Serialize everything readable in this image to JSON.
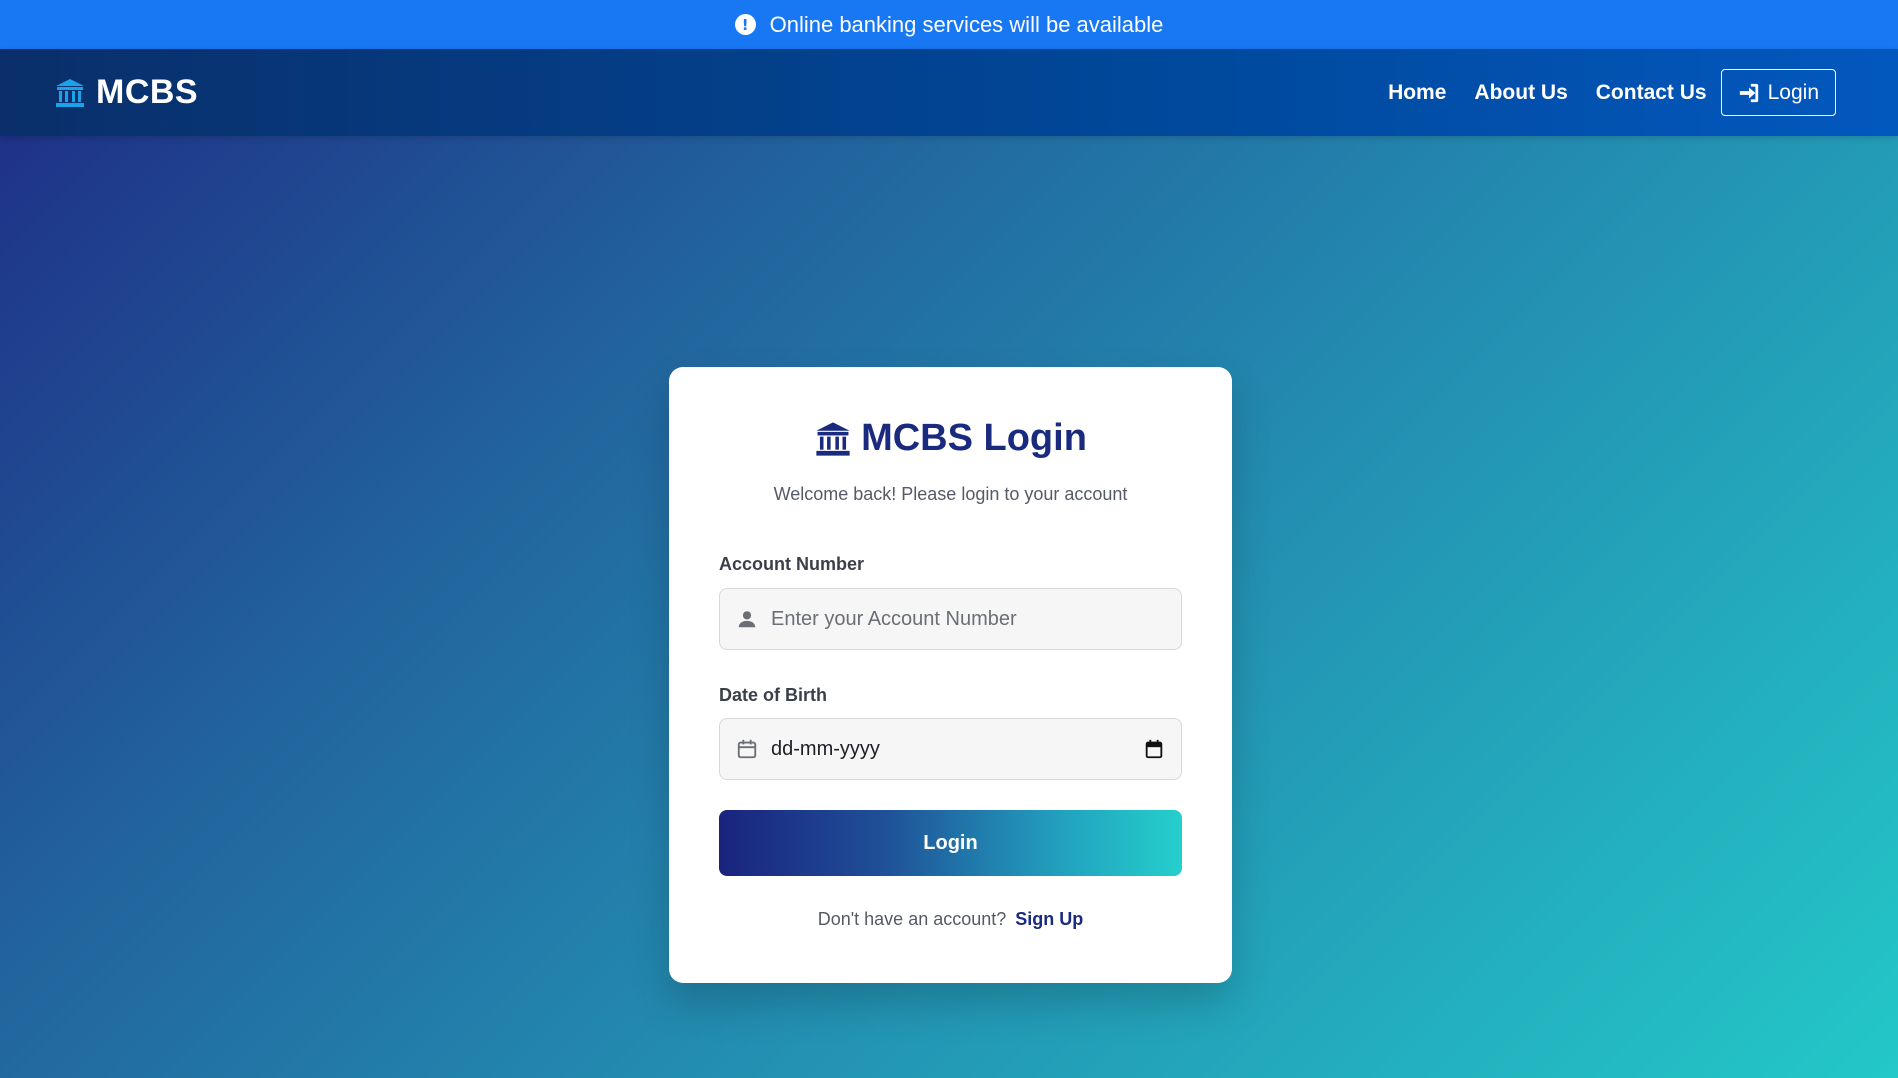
{
  "announcement": {
    "text": "Online banking services will be available",
    "icon": "exclamation-circle-icon"
  },
  "navbar": {
    "brand": {
      "text": "MCBS",
      "icon": "bank-icon",
      "icon_color": "#1aa3e8"
    },
    "links": [
      "Home",
      "About Us",
      "Contact Us"
    ],
    "login_label": "Login",
    "login_icon": "sign-in-icon"
  },
  "login_card": {
    "title": "MCBS Login",
    "title_icon": "bank-icon",
    "subtitle": "Welcome back! Please login to your account",
    "account_number": {
      "label": "Account Number",
      "placeholder": "Enter your Account Number",
      "value": "",
      "icon": "user-icon"
    },
    "date_of_birth": {
      "label": "Date of Birth",
      "value": "dd-mm-yyyy",
      "icon": "calendar-icon",
      "picker_icon": "calendar-picker-icon"
    },
    "submit_label": "Login",
    "signup_prompt": "Don't have an account?",
    "signup_link": "Sign Up"
  },
  "colors": {
    "announcement_bg": "#1877f2",
    "navbar_bg": "#00489a",
    "brand_primary": "#1a2a7e",
    "accent_teal": "#24cfcc"
  }
}
